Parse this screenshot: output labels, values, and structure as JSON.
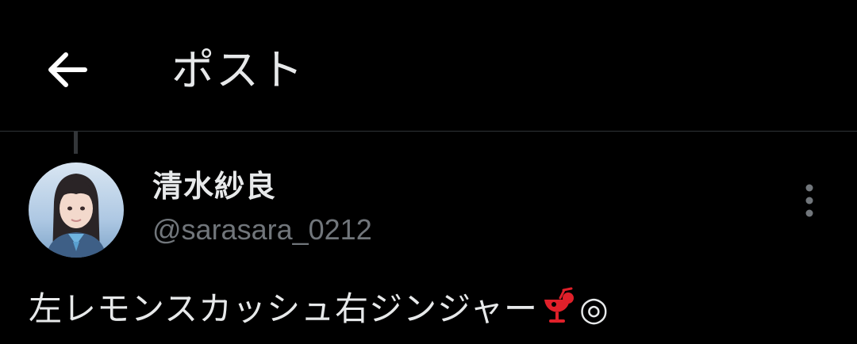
{
  "header": {
    "title": "ポスト",
    "back_icon": "arrow-left-icon"
  },
  "author": {
    "display_name": "清水紗良",
    "handle": "@sarasara_0212",
    "avatar_icon": "profile-photo"
  },
  "post": {
    "text_before_emoji": "左レモンスカッシュ右ジンジャー",
    "emoji_icon": "tropical-drink-icon",
    "text_after_emoji": "◎"
  },
  "menu_icon": "more-vertical-icon",
  "colors": {
    "background": "#000000",
    "primary_text": "#e7e9ea",
    "secondary_text": "#71767b",
    "divider": "#2f3336",
    "emoji_red": "#e0202a"
  }
}
